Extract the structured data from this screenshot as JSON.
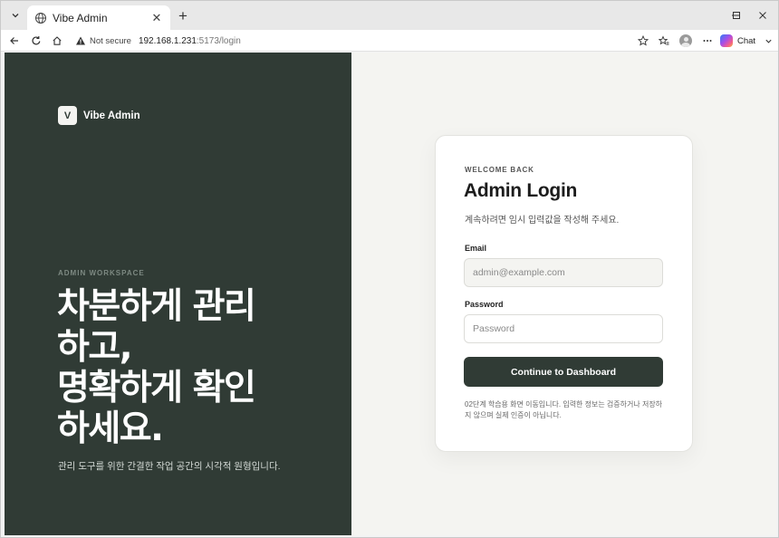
{
  "browser": {
    "tab_title": "Vibe Admin",
    "security_label": "Not secure",
    "url_host": "192.168.1.231",
    "url_path": ":5173/login",
    "chat_label": "Chat"
  },
  "brand": {
    "mark": "V",
    "name": "Vibe Admin"
  },
  "hero": {
    "eyebrow": "ADMIN WORKSPACE",
    "headline": "차분하게 관리\n하고,\n명확하게 확인\n하세요.",
    "subcopy": "관리 도구를 위한 간결한 작업 공간의 시각적 원형입니다."
  },
  "login": {
    "kicker": "WELCOME BACK",
    "title": "Admin Login",
    "description": "계속하려면 임시 입력값을 작성해 주세요.",
    "email_label": "Email",
    "email_placeholder": "admin@example.com",
    "email_value": "",
    "password_label": "Password",
    "password_placeholder": "Password",
    "password_value": "",
    "submit_label": "Continue to Dashboard",
    "note": "02단계 학습용 화면 이동입니다. 입력한 정보는 검증하거나 저장하지 않으며 실제 인증이 아닙니다."
  },
  "colors": {
    "panel": "#303b35",
    "page_bg": "#f4f4f1",
    "button": "#303b35"
  },
  "icons": [
    "tab-search-icon",
    "globe-icon",
    "close-icon",
    "plus-icon",
    "minimize-icon",
    "maximize-icon",
    "window-close-icon",
    "back-arrow-icon",
    "reload-icon",
    "home-icon",
    "warning-icon",
    "star-icon",
    "favorites-icon",
    "profile-icon",
    "more-icon",
    "copilot-icon",
    "chevron-down-icon"
  ]
}
